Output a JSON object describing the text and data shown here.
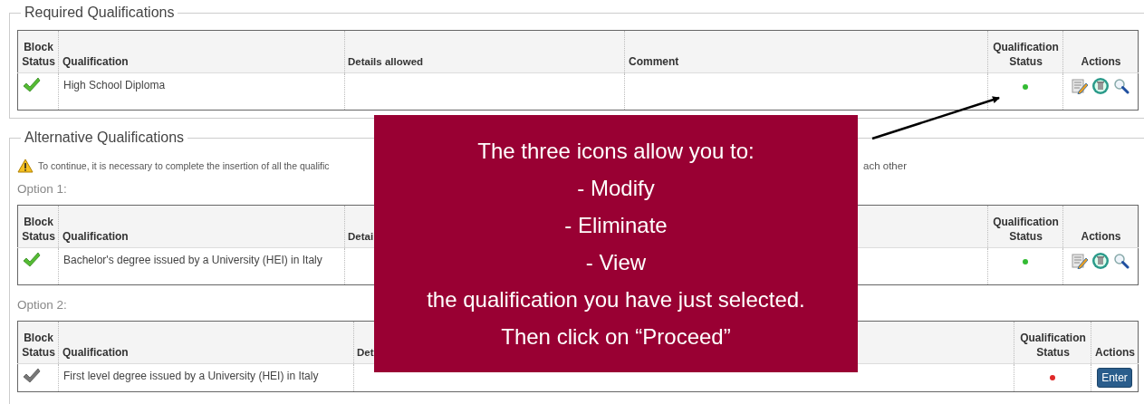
{
  "required": {
    "legend": "Required Qualifications",
    "table": {
      "columns": [
        "Block Status",
        "Qualification",
        "Details allowed",
        "Comment",
        "Qualification Status",
        "Actions"
      ],
      "rows": [
        {
          "checked": true,
          "qualification": "High School Diploma",
          "color": "#33bb33",
          "actions": {
            "kind": "icons"
          }
        }
      ]
    }
  },
  "alternative": {
    "legend": "Alternative Qualifications",
    "warning": [
      "To continue, it is necessary to complete the insertion of all the qualific",
      "ach other"
    ],
    "options": [
      {
        "label": "Option 1:",
        "table": {
          "columns": [
            "Block Status",
            "Qualification",
            "Detai",
            "Qualification Status",
            "Actions"
          ],
          "rows": [
            {
              "checked": true,
              "qualification": "Bachelor's degree issued by a University (HEI) in Italy",
              "color": "#33bb33",
              "actions": {
                "kind": "icons"
              }
            }
          ]
        }
      },
      {
        "label": "Option 2:",
        "table": {
          "columns": [
            "Block Status",
            "Qualification",
            "Det",
            "Qualification Status",
            "Actions"
          ],
          "rows": [
            {
              "checked": false,
              "qualification": "First level degree issued by a University (HEI) in Italy",
              "color": "#e02828",
              "actions": {
                "kind": "button",
                "label": "Enter"
              }
            }
          ]
        }
      }
    ]
  },
  "callout": {
    "lines": [
      "The three icons allow you to:",
      "- Modify",
      "- Eliminate",
      "- View",
      "the qualification you have just selected.",
      "Then click on “Proceed”"
    ]
  }
}
